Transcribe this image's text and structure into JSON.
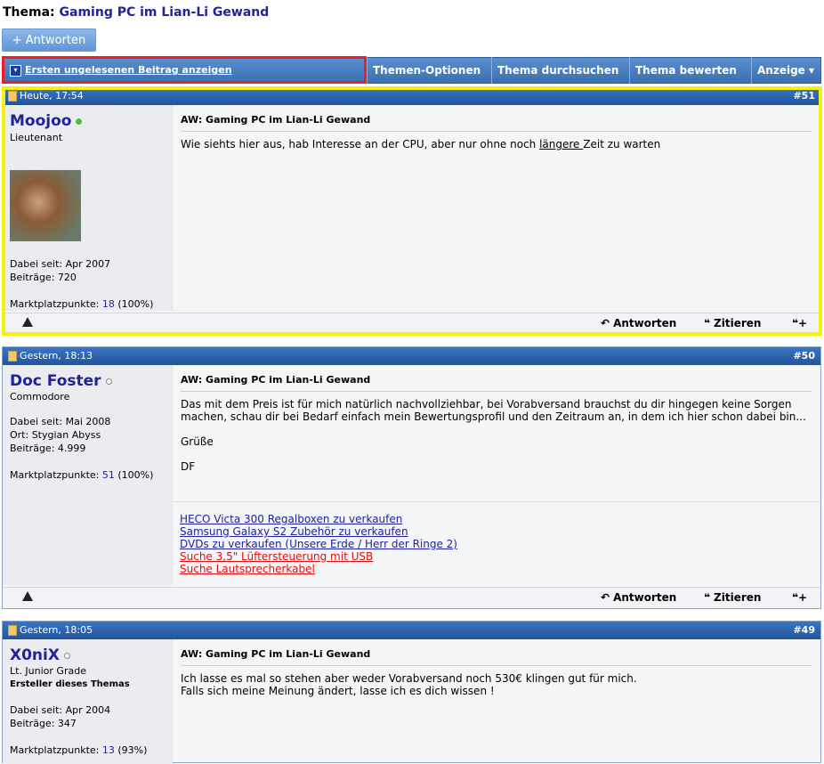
{
  "thread": {
    "prefix": "Thema:",
    "title": "Gaming PC im Lian-Li Gewand"
  },
  "reply_button": "+ Antworten",
  "toolbar": {
    "unread": "Ersten ungelesenen Beitrag anzeigen",
    "menus": [
      "Themen-Optionen ▾",
      "Thema durchsuchen ▾",
      "Thema bewerten ▾",
      "Anzeige ▾"
    ]
  },
  "posts": [
    {
      "date": "Heute, 17:54",
      "number": "#51",
      "user": "Moojoo",
      "online": true,
      "rank": "Lieutenant",
      "joined": "Dabei seit: Apr 2007",
      "posts": "Beiträge: 720",
      "market_label": "Marktplatzpunkte:",
      "market_value": "18",
      "market_pct": "(100%)",
      "title": "AW: Gaming PC im Lian-Li Gewand",
      "text_a": "Wie siehts hier aus, hab Interesse an der CPU, aber nur ohne noch ",
      "text_u": "längere ",
      "text_b": "Zeit zu warten"
    },
    {
      "date": "Gestern, 18:13",
      "number": "#50",
      "user": "Doc Foster",
      "online": false,
      "rank": "Commodore",
      "joined": "Dabei seit: Mai 2008",
      "location": "Ort: Stygian Abyss",
      "posts": "Beiträge: 4.999",
      "market_label": "Marktplatzpunkte:",
      "market_value": "51",
      "market_pct": "(100%)",
      "title": "AW: Gaming PC im Lian-Li Gewand",
      "text1": "Das mit dem Preis ist für mich natürlich nachvollziehbar, bei Vorabversand brauchst du dir hingegen keine Sorgen machen, schau dir bei Bedarf einfach mein Bewertungsprofil und den Zeitraum an, in dem ich hier schon dabei bin...",
      "text2": "Grüße",
      "text3": "DF",
      "sig": [
        "HECO Victa 300 Regalboxen zu verkaufen",
        "Samsung Galaxy S2 Zubehör zu verkaufen",
        "DVDs zu verkaufen (Unsere Erde / Herr der Ringe 2)",
        "Suche 3,5\" Lüftersteuerung mit USB",
        "Suche Lautsprecherkabel"
      ]
    },
    {
      "date": "Gestern, 18:05",
      "number": "#49",
      "user": "X0niX",
      "online": false,
      "rank": "Lt. Junior Grade",
      "starter": "Ersteller dieses Themas",
      "joined": "Dabei seit: Apr 2004",
      "posts": "Beiträge: 347",
      "market_label": "Marktplatzpunkte:",
      "market_value": "13",
      "market_pct": "(93%)",
      "title": "AW: Gaming PC im Lian-Li Gewand",
      "text1": "Ich lasse es mal so stehen aber weder Vorabversand noch 530€ klingen gut für mich.",
      "text2": "Falls sich meine Meinung ändert, lasse ich es dich wissen !"
    }
  ],
  "actions": {
    "reply": "Antworten",
    "quote": "Zitieren"
  },
  "colors": {
    "link": "#22229c",
    "header": "#2a5fa8",
    "highlight_red": "#e8202a",
    "highlight_yellow": "#f5f10a",
    "sig_red": "#e01010"
  }
}
